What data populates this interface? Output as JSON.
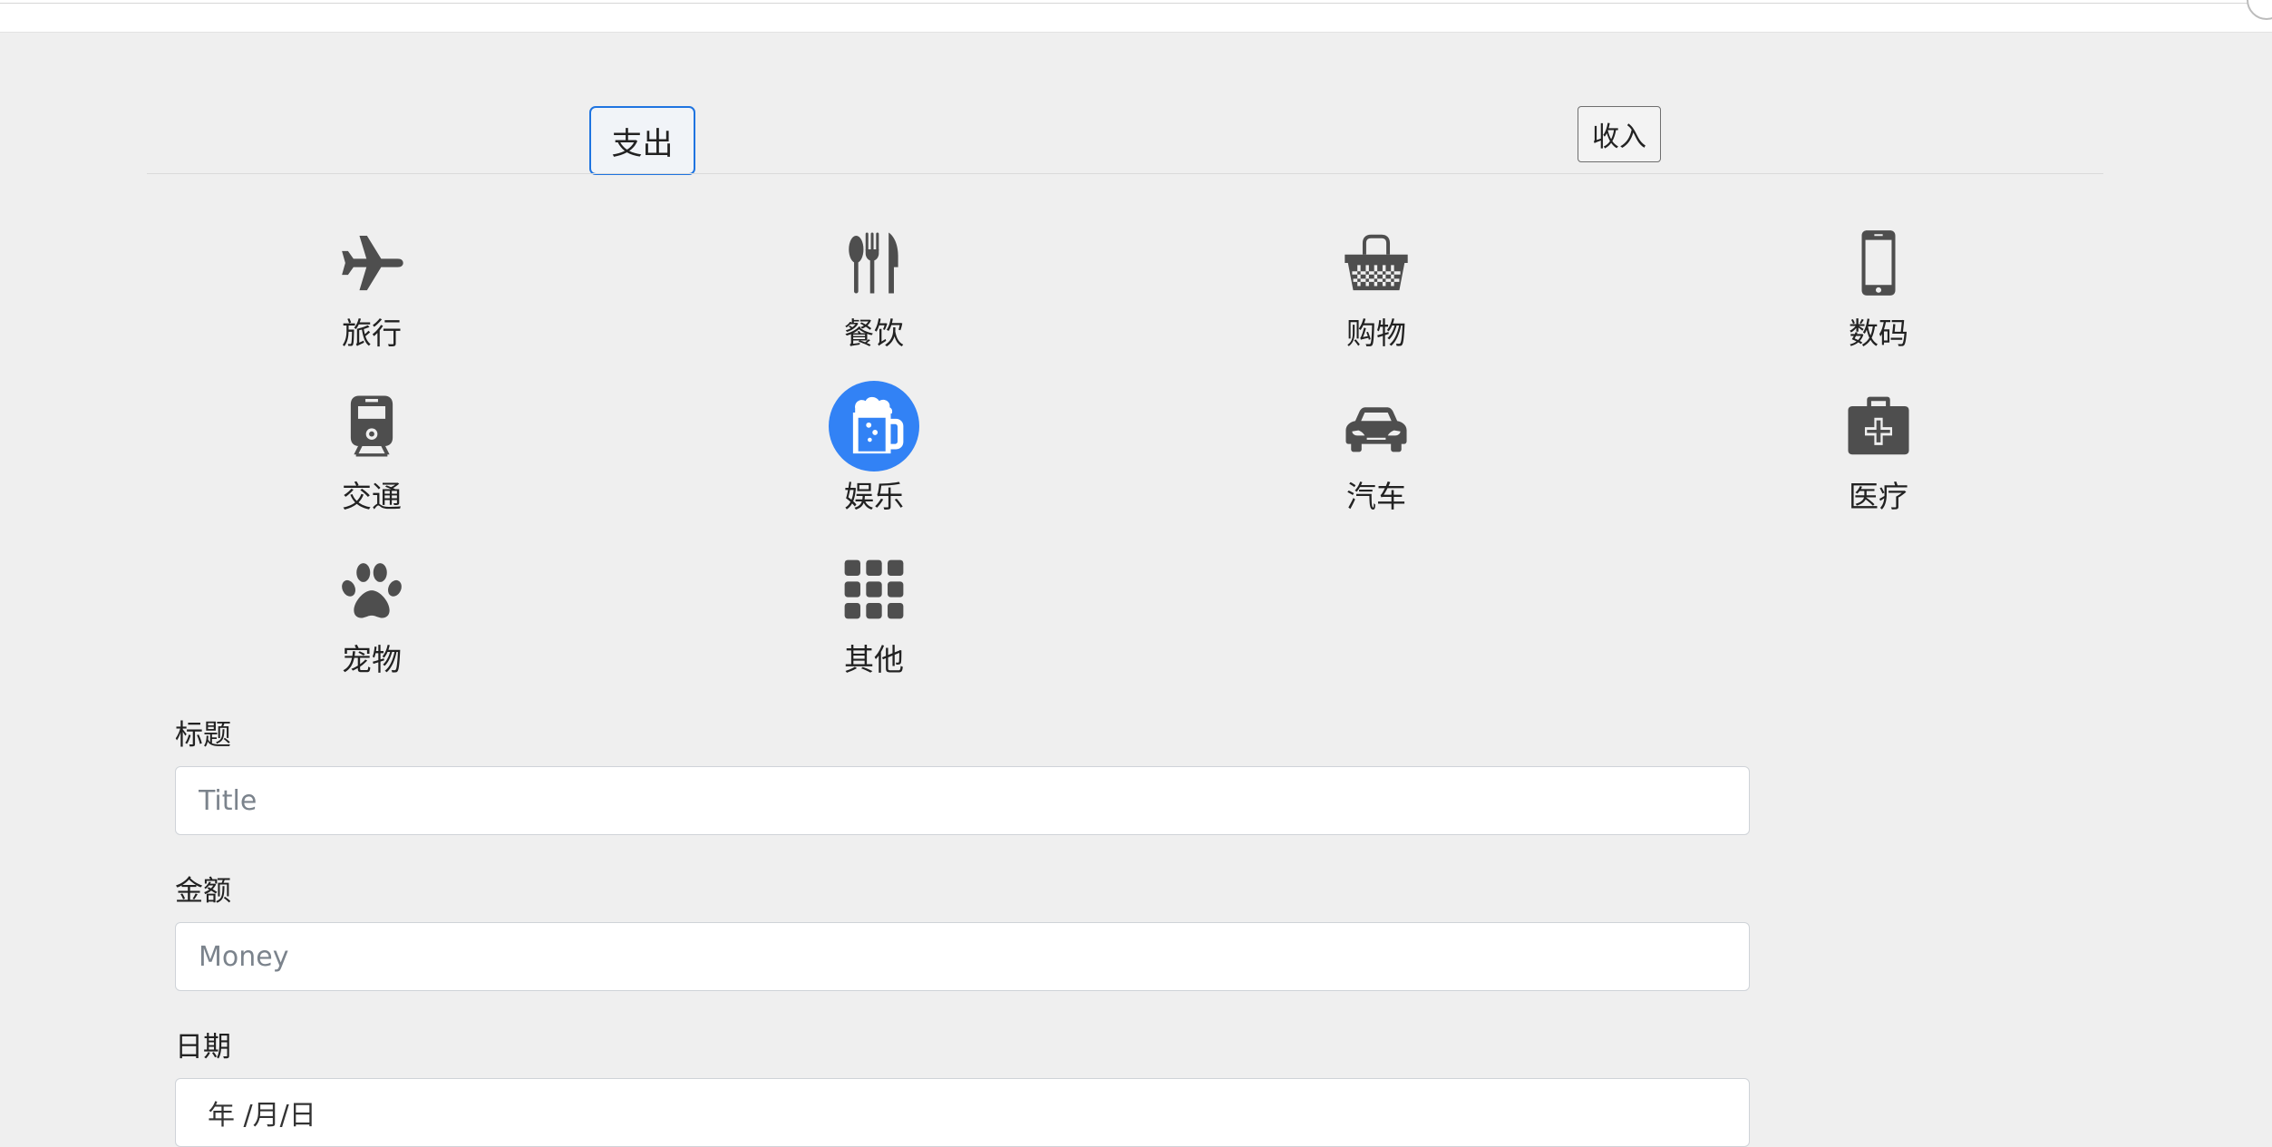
{
  "tabs": {
    "expense": "支出",
    "income": "收入"
  },
  "categories": [
    {
      "label": "旅行",
      "icon": "plane-icon"
    },
    {
      "label": "餐饮",
      "icon": "utensils-icon"
    },
    {
      "label": "购物",
      "icon": "basket-icon"
    },
    {
      "label": "数码",
      "icon": "phone-icon"
    },
    {
      "label": "交通",
      "icon": "train-icon"
    },
    {
      "label": "娱乐",
      "icon": "beer-mug-icon",
      "selected": true
    },
    {
      "label": "汽车",
      "icon": "car-icon"
    },
    {
      "label": "医疗",
      "icon": "medkit-icon"
    },
    {
      "label": "宠物",
      "icon": "paw-icon"
    },
    {
      "label": "其他",
      "icon": "grid-icon"
    }
  ],
  "form": {
    "title": {
      "label": "标题",
      "placeholder": "Title",
      "value": ""
    },
    "money": {
      "label": "金额",
      "placeholder": "Money",
      "value": ""
    },
    "date": {
      "label": "日期",
      "display": "年 /月/日"
    }
  },
  "colors": {
    "accent": "#3282f5",
    "tab_active_border": "#1f74e0",
    "icon": "#4e4e4e",
    "background": "#efefef"
  }
}
